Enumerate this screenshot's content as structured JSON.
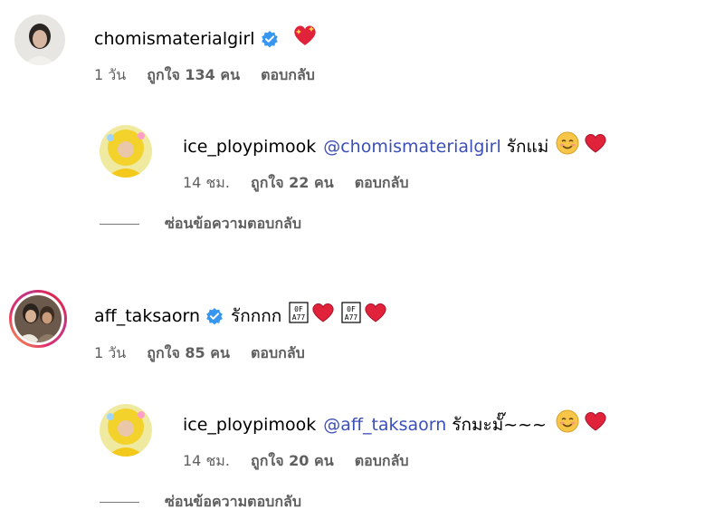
{
  "comments": [
    {
      "username": "chomismaterialgirl",
      "verified": true,
      "text": "",
      "emoji": "sparkling-heart",
      "time": "1 วัน",
      "likes": "ถูกใจ 134 คน",
      "reply_label": "ตอบกลับ",
      "reply": {
        "username": "ice_ploypimook",
        "mention": "@chomismaterialgirl",
        "text": "รักแม่",
        "emoji": [
          "smiling-face",
          "red-heart"
        ],
        "time": "14 ชม.",
        "likes": "ถูกใจ 22 คน",
        "reply_label": "ตอบกลับ"
      },
      "hide_replies_label": "ซ่อนข้อความตอบกลับ"
    },
    {
      "username": "aff_taksaorn",
      "verified": true,
      "text": "รักกกก",
      "emoji": [
        "unknown-glyph",
        "red-heart",
        "unknown-glyph",
        "red-heart"
      ],
      "time": "1 วัน",
      "likes": "ถูกใจ 85 คน",
      "reply_label": "ตอบกลับ",
      "reply": {
        "username": "ice_ploypimook",
        "mention": "@aff_taksaorn",
        "text": "รักมะมั๊~~~",
        "emoji": [
          "smiling-face",
          "red-heart"
        ],
        "time": "14 ชม.",
        "likes": "ถูกใจ 20 คน",
        "reply_label": "ตอบกลับ"
      },
      "hide_replies_label": "ซ่อนข้อความตอบกลับ"
    }
  ],
  "colors": {
    "mention": "#3b4fb8",
    "verified": "#3797f0",
    "meta": "#5f5f5f",
    "heart": "#e0233a"
  }
}
